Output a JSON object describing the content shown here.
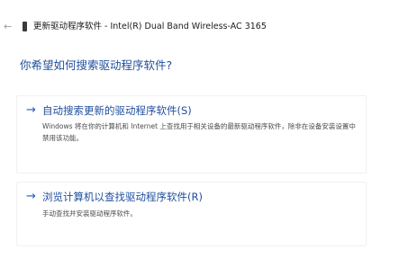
{
  "titlebar": {
    "title": "更新驱动程序软件 - Intel(R) Dual Band Wireless-AC 3165",
    "back_icon": "back-arrow-icon",
    "device_icon": "network-adapter-icon"
  },
  "main": {
    "heading": "你希望如何搜索驱动程序软件?",
    "options": [
      {
        "title": "自动搜索更新的驱动程序软件(S)",
        "description": "Windows 将在你的计算机和 Internet 上查找用于相关设备的最新驱动程序软件，除非在设备安装设置中禁用该功能。",
        "icon": "arrow-right-icon"
      },
      {
        "title": "浏览计算机以查找驱动程序软件(R)",
        "description": "手动查找并安装驱动程序软件。",
        "icon": "arrow-right-icon"
      }
    ]
  },
  "colors": {
    "accent": "#1f4e9c",
    "text": "#1a1a1a",
    "secondary_text": "#4a4a4a",
    "background": "#ffffff"
  }
}
